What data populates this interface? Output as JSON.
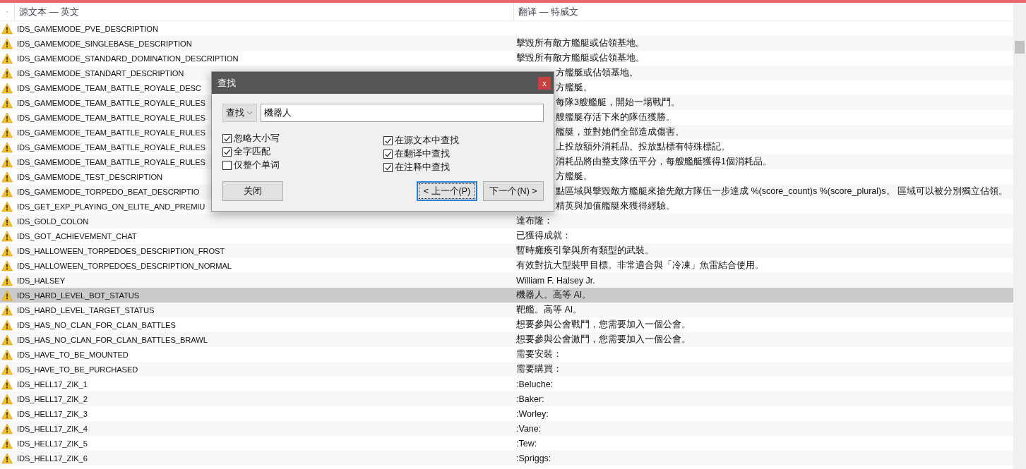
{
  "header": {
    "marker": "·",
    "columns": [
      "源文本 — 英文",
      "翻译 — 特威文"
    ]
  },
  "rows": [
    {
      "source": "IDS_GAMEMODE_PVE_DESCRIPTION",
      "selected": false
    },
    {
      "source": "IDS_GAMEMODE_SINGLEBASE_DESCRIPTION",
      "translation": "擊毀所有敵方艦艇或佔領基地。",
      "selected": false
    },
    {
      "source": "IDS_GAMEMODE_STANDARD_DOMINATION_DESCRIPTION",
      "translation": "擊毀所有敵方艦艇或佔領基地。",
      "selected": false
    },
    {
      "source": "IDS_GAMEMODE_STANDART_DESCRIPTION",
      "translation": "方艦艇或佔領基地。",
      "selected": false
    },
    {
      "source": "IDS_GAMEMODE_TEAM_BATTLE_ROYALE_DESC",
      "translation": "方艦艇。",
      "selected": false
    },
    {
      "source": "IDS_GAMEMODE_TEAM_BATTLE_ROYALE_RULES",
      "translation": "每隊3艘艦艇，開始一場戰鬥。",
      "selected": false
    },
    {
      "source": "IDS_GAMEMODE_TEAM_BATTLE_ROYALE_RULES",
      "translation": "艘艦艇存活下來的隊伍獲勝。",
      "selected": false
    },
    {
      "source": "IDS_GAMEMODE_TEAM_BATTLE_ROYALE_RULES",
      "translation": "艦艇，並對她們全部造成傷害。",
      "selected": false
    },
    {
      "source": "IDS_GAMEMODE_TEAM_BATTLE_ROYALE_RULES",
      "translation": "上投放額外消耗品。投放點標有特殊標記。",
      "selected": false
    },
    {
      "source": "IDS_GAMEMODE_TEAM_BATTLE_ROYALE_RULES",
      "translation": "消耗品將由整支隊伍平分，每艘艦艇獲得1個消耗品。",
      "selected": false
    },
    {
      "source": "IDS_GAMEMODE_TEST_DESCRIPTION",
      "translation": "方艦艇。",
      "selected": false
    },
    {
      "source": "IDS_GAMEMODE_TORPEDO_BEAT_DESCRIPTIO",
      "translation": "點區域與擊毀敵方艦艇來搶先敵方隊伍一步達成 %(score_count)s %(score_plural)s。 區域可以被分別獨立佔領。",
      "selected": false
    },
    {
      "source": "IDS_GET_EXP_PLAYING_ON_ELITE_AND_PREMIU",
      "translation": "精英與加值艦艇來獲得經驗。",
      "selected": false
    },
    {
      "source": "IDS_GOLD_COLON",
      "translation": "達布隆：",
      "selected": false
    },
    {
      "source": "IDS_GOT_ACHIEVEMENT_CHAT",
      "translation": "已獲得成就：",
      "selected": false
    },
    {
      "source": "IDS_HALLOWEEN_TORPEDOES_DESCRIPTION_FROST",
      "translation": "暫時癱瘓引擎與所有類型的武裝。",
      "selected": false
    },
    {
      "source": "IDS_HALLOWEEN_TORPEDOES_DESCRIPTION_NORMAL",
      "translation": "有效對抗大型裝甲目標。非常適合與「冷凍」魚雷結合使用。",
      "selected": false
    },
    {
      "source": "IDS_HALSEY",
      "translation": "William F. Halsey Jr.",
      "selected": false
    },
    {
      "source": "IDS_HARD_LEVEL_BOT_STATUS",
      "translation": "機器人。高等 AI。",
      "selected": true
    },
    {
      "source": "IDS_HARD_LEVEL_TARGET_STATUS",
      "translation": "靶艦。高等 AI。",
      "selected": false
    },
    {
      "source": "IDS_HAS_NO_CLAN_FOR_CLAN_BATTLES",
      "translation": "想要參與公會戰鬥，您需要加入一個公會。",
      "selected": false
    },
    {
      "source": "IDS_HAS_NO_CLAN_FOR_CLAN_BATTLES_BRAWL",
      "translation": "想要參與公會激鬥，您需要加入一個公會。",
      "selected": false
    },
    {
      "source": "IDS_HAVE_TO_BE_MOUNTED",
      "translation": "需要安裝：",
      "selected": false
    },
    {
      "source": "IDS_HAVE_TO_BE_PURCHASED",
      "translation": "需要購買：",
      "selected": false
    },
    {
      "source": "IDS_HELL17_ZIK_1",
      "translation": ":Beluche:",
      "selected": false
    },
    {
      "source": "IDS_HELL17_ZIK_2",
      "translation": ":Baker:",
      "selected": false
    },
    {
      "source": "IDS_HELL17_ZIK_3",
      "translation": ":Worley:",
      "selected": false
    },
    {
      "source": "IDS_HELL17_ZIK_4",
      "translation": ":Vane:",
      "selected": false
    },
    {
      "source": "IDS_HELL17_ZIK_5",
      "translation": ":Tew:",
      "selected": false
    },
    {
      "source": "IDS_HELL17_ZIK_6",
      "translation": ":Spriggs:",
      "selected": false
    }
  ],
  "dialog": {
    "title": "查找",
    "close": "x",
    "mode": "查找",
    "query": "機器人",
    "options_left": [
      {
        "label": "忽略大小写",
        "checked": true
      },
      {
        "label": "全字匹配",
        "checked": true
      },
      {
        "label": "仅整个单词",
        "checked": false
      }
    ],
    "options_right": [
      {
        "label": "在源文本中查找",
        "checked": true
      },
      {
        "label": "在翻译中查找",
        "checked": true
      },
      {
        "label": "在注释中查找",
        "checked": true
      }
    ],
    "close_button": "关闭",
    "prev_button": "< 上一个(P)",
    "next_button": "下一个(N) >"
  }
}
